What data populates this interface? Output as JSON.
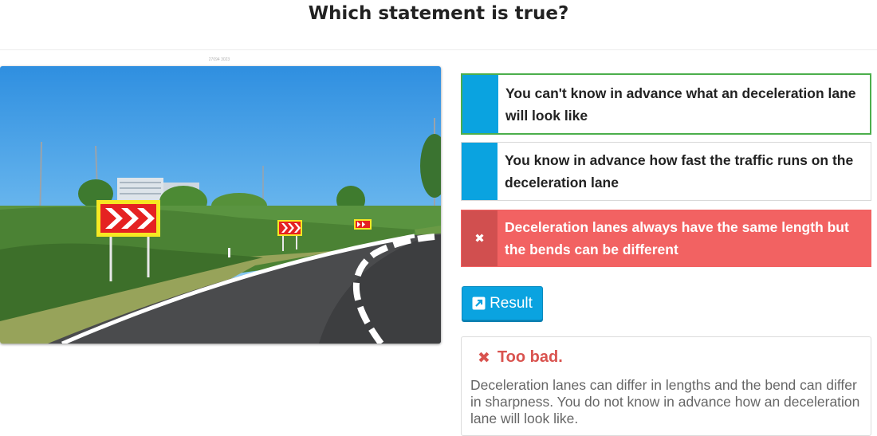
{
  "question": {
    "title": "Which statement is true?"
  },
  "image": {
    "caption": "27094 3023"
  },
  "answers": [
    {
      "text": "You can't know in advance what an deceleration lane will look like",
      "state": "correct"
    },
    {
      "text": "You know in advance how fast the traffic runs on the deceleration lane",
      "state": "neutral"
    },
    {
      "text": "Deceleration lanes always have the same length but the bends can be different",
      "state": "wrong-selected"
    }
  ],
  "result_button": {
    "label": "Result",
    "icon": "external-link-icon"
  },
  "feedback": {
    "heading": "Too bad.",
    "icon": "cross-icon",
    "body": "Deceleration lanes can differ in lengths and the bend can differ in sharpness. You do not know in advance how an deceleration lane will look like."
  },
  "colors": {
    "accent": "#0aa3e0",
    "correct_border": "#4cae4c",
    "wrong_bg": "#f26262",
    "wrong_marker": "#d14f4f",
    "feedback_heading": "#d9534f"
  }
}
